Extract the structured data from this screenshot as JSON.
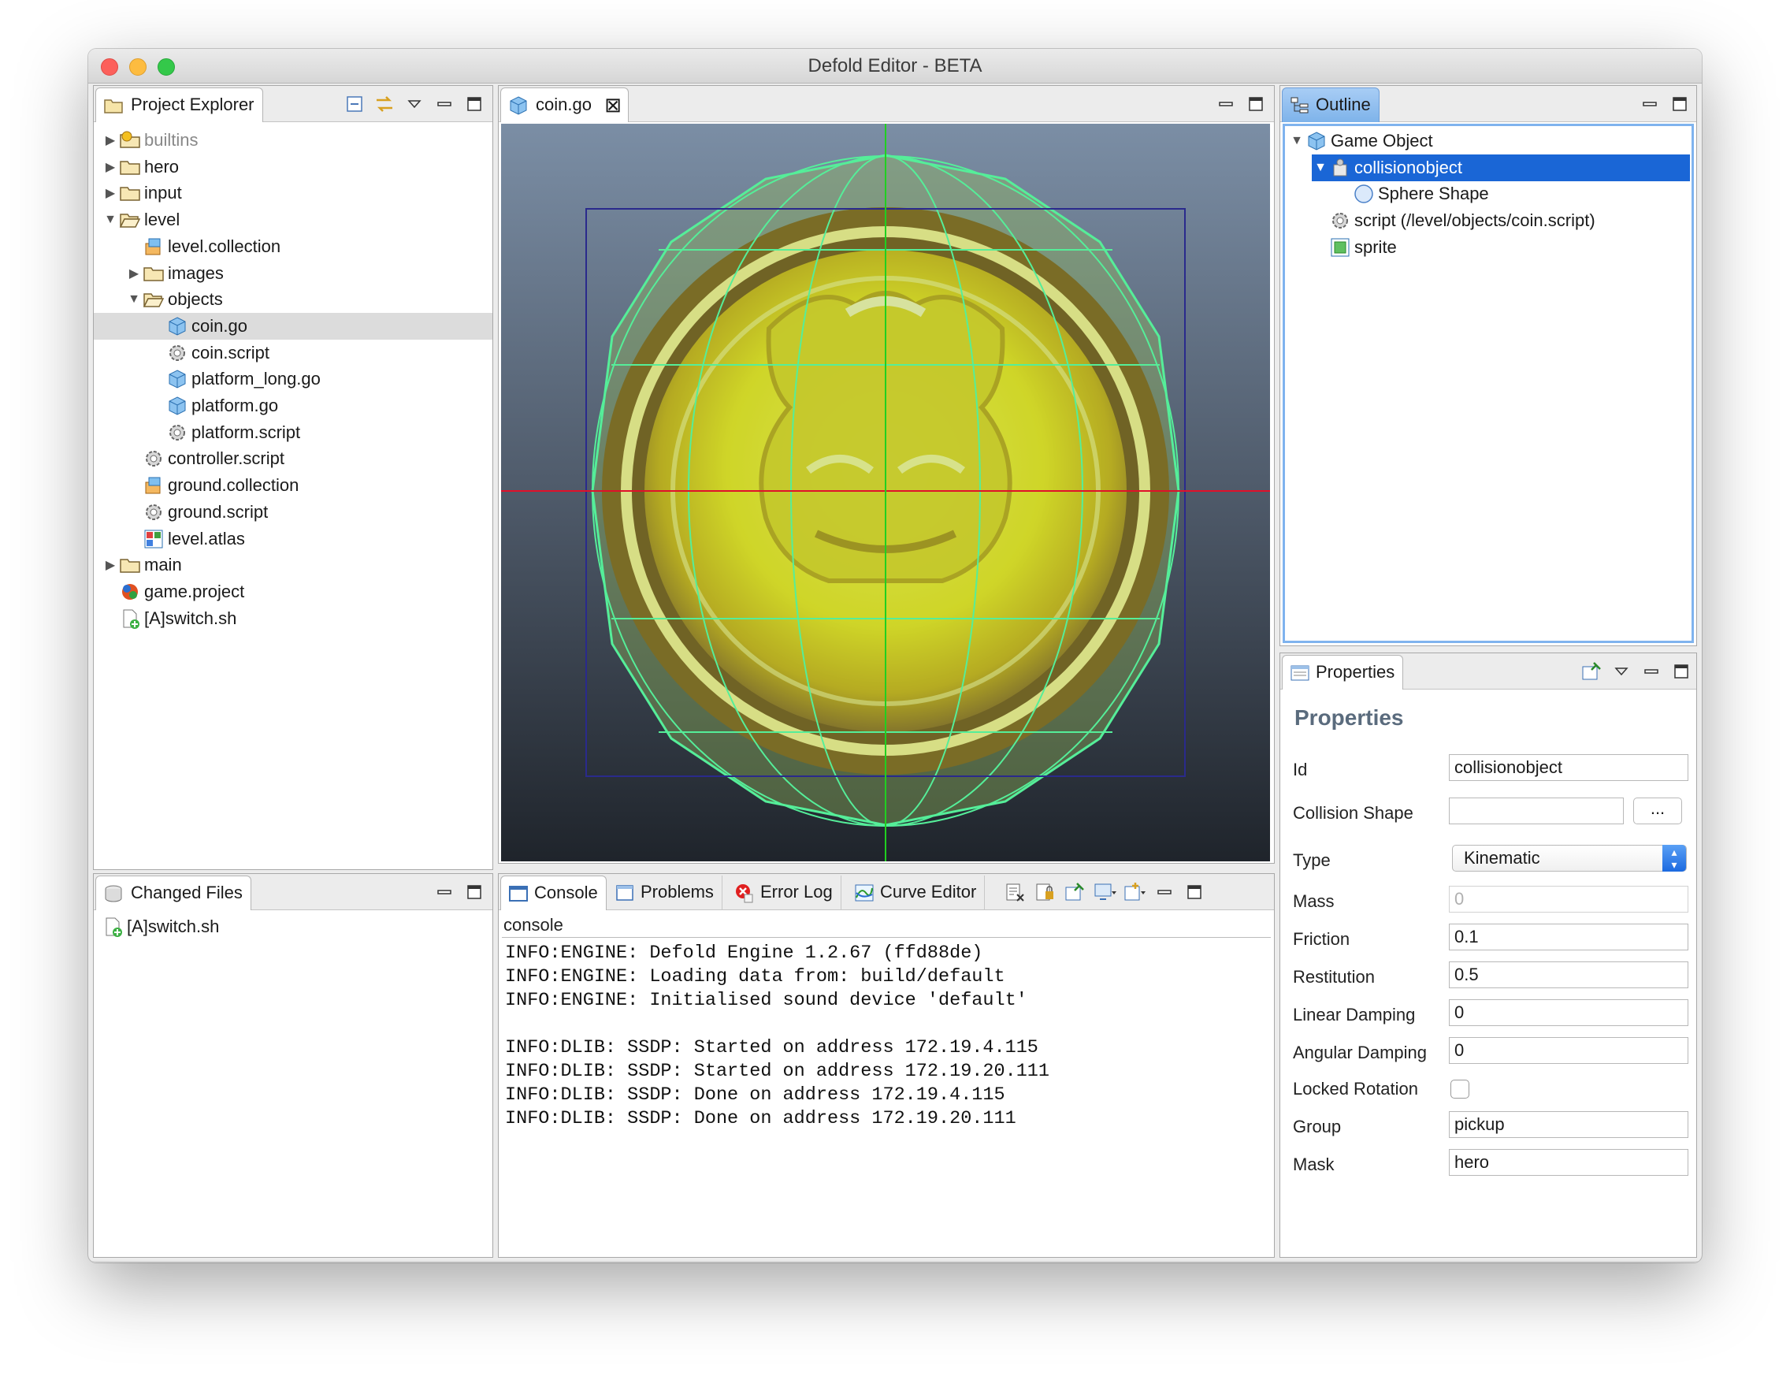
{
  "window": {
    "title": "Defold Editor - BETA"
  },
  "project_explorer": {
    "tab_label": "Project Explorer",
    "tree": [
      {
        "label": "builtins",
        "icon": "package-folder-icon",
        "level": 0,
        "expander": "collapsed",
        "dim": true
      },
      {
        "label": "hero",
        "icon": "folder-icon",
        "level": 0,
        "expander": "collapsed"
      },
      {
        "label": "input",
        "icon": "folder-icon",
        "level": 0,
        "expander": "collapsed"
      },
      {
        "label": "level",
        "icon": "folder-open-icon",
        "level": 0,
        "expander": "expanded"
      },
      {
        "label": "level.collection",
        "icon": "collection-icon",
        "level": 1,
        "expander": "none"
      },
      {
        "label": "images",
        "icon": "folder-icon",
        "level": 1,
        "expander": "collapsed"
      },
      {
        "label": "objects",
        "icon": "folder-open-icon",
        "level": 1,
        "expander": "expanded"
      },
      {
        "label": "coin.go",
        "icon": "game-object-icon",
        "level": 2,
        "expander": "none",
        "selected": true
      },
      {
        "label": "coin.script",
        "icon": "script-gear-icon",
        "level": 2,
        "expander": "none"
      },
      {
        "label": "platform_long.go",
        "icon": "game-object-icon",
        "level": 2,
        "expander": "none"
      },
      {
        "label": "platform.go",
        "icon": "game-object-icon",
        "level": 2,
        "expander": "none"
      },
      {
        "label": "platform.script",
        "icon": "script-gear-icon",
        "level": 2,
        "expander": "none"
      },
      {
        "label": "controller.script",
        "icon": "script-gear-icon",
        "level": 1,
        "expander": "none"
      },
      {
        "label": "ground.collection",
        "icon": "collection-icon",
        "level": 1,
        "expander": "none"
      },
      {
        "label": "ground.script",
        "icon": "script-gear-icon",
        "level": 1,
        "expander": "none"
      },
      {
        "label": "level.atlas",
        "icon": "atlas-icon",
        "level": 1,
        "expander": "none"
      },
      {
        "label": "main",
        "icon": "folder-icon",
        "level": 0,
        "expander": "collapsed"
      },
      {
        "label": "game.project",
        "icon": "project-icon",
        "level": 0,
        "expander": "none"
      },
      {
        "label": "[A]switch.sh",
        "icon": "added-file-icon",
        "level": 0,
        "expander": "none"
      }
    ]
  },
  "changed_files": {
    "tab_label": "Changed Files",
    "items": [
      "[A]switch.sh"
    ]
  },
  "editor": {
    "tab_label": "coin.go"
  },
  "console": {
    "tabs": [
      "Console",
      "Problems",
      "Error Log",
      "Curve Editor"
    ],
    "subtitle": "console",
    "text": "INFO:ENGINE: Defold Engine 1.2.67 (ffd88de)\nINFO:ENGINE: Loading data from: build/default\nINFO:ENGINE: Initialised sound device 'default'\n\nINFO:DLIB: SSDP: Started on address 172.19.4.115\nINFO:DLIB: SSDP: Started on address 172.19.20.111\nINFO:DLIB: SSDP: Done on address 172.19.4.115\nINFO:DLIB: SSDP: Done on address 172.19.20.111"
  },
  "outline": {
    "tab_label": "Outline",
    "items": [
      {
        "label": "Game Object",
        "icon": "game-object-icon",
        "level": 0,
        "expander": "expanded"
      },
      {
        "label": "collisionobject",
        "icon": "collision-object-icon",
        "level": 1,
        "expander": "expanded",
        "selected": true
      },
      {
        "label": "Sphere Shape",
        "icon": "sphere-icon",
        "level": 2,
        "expander": "none"
      },
      {
        "label": "script (/level/objects/coin.script)",
        "icon": "script-gear-icon",
        "level": 1,
        "expander": "none"
      },
      {
        "label": "sprite",
        "icon": "sprite-icon",
        "level": 1,
        "expander": "none"
      }
    ]
  },
  "properties": {
    "tab_label": "Properties",
    "title": "Properties",
    "id_label": "Id",
    "id_value": "collisionobject",
    "collision_shape_label": "Collision Shape",
    "collision_shape_value": "",
    "browse_label": "...",
    "type_label": "Type",
    "type_value": "Kinematic",
    "mass_label": "Mass",
    "mass_value": "0",
    "friction_label": "Friction",
    "friction_value": "0.1",
    "restitution_label": "Restitution",
    "restitution_value": "0.5",
    "linear_damping_label": "Linear Damping",
    "linear_damping_value": "0",
    "angular_damping_label": "Angular Damping",
    "angular_damping_value": "0",
    "locked_rotation_label": "Locked Rotation",
    "locked_rotation_checked": false,
    "group_label": "Group",
    "group_value": "pickup",
    "mask_label": "Mask",
    "mask_value": "hero"
  },
  "colors": {
    "selection_blue": "#1a66d6",
    "outline_tab_blue": "#7eb3ea",
    "collision_green": "#55ee99",
    "coin_yellow": "#f2e40a",
    "axis_red": "#e0102a",
    "axis_green": "#20d020"
  }
}
